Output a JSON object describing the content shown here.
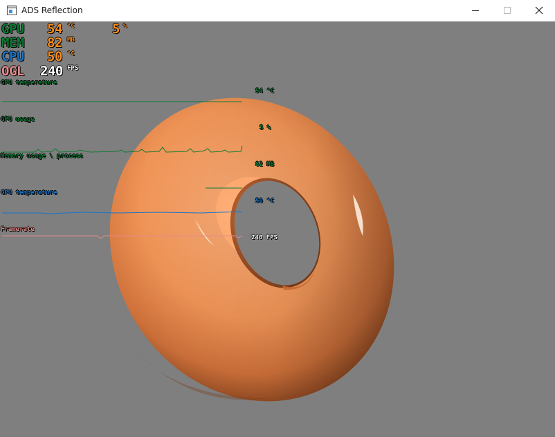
{
  "window": {
    "title": "ADS Reflection",
    "icon": "app-window-icon",
    "controls": {
      "minimize": "minimize-icon",
      "maximize": "maximize-icon",
      "close": "close-icon"
    }
  },
  "colors": {
    "viewport_bg": "#7f7f7f",
    "torus": "#f59a5e",
    "gpu": "#0c7a34",
    "value": "#ff8c1a",
    "cpu": "#1a74c8",
    "ogl": "#e58a8a"
  },
  "osd": {
    "gpu": {
      "label": "GPU",
      "temp": "54",
      "temp_unit": "°C",
      "usage": "5",
      "usage_unit": "%"
    },
    "mem": {
      "label": "MEM",
      "value": "82",
      "unit": "MB"
    },
    "cpu": {
      "label": "CPU",
      "temp": "50",
      "temp_unit": "°C"
    },
    "ogl": {
      "label": "OGL",
      "fps": "240",
      "fps_unit": "FPS"
    }
  },
  "graphs": {
    "gpu_temp": {
      "label": "GPU temperature",
      "value": "54 °C"
    },
    "gpu_usage": {
      "label": "GPU usage",
      "value": "5 %"
    },
    "memory": {
      "label": "Memory usage \\ process",
      "value": "82 MB"
    },
    "cpu_temp": {
      "label": "CPU temperature",
      "value": "50 °C"
    },
    "framerate": {
      "label": "Framerate",
      "value": "240 FPS"
    }
  }
}
